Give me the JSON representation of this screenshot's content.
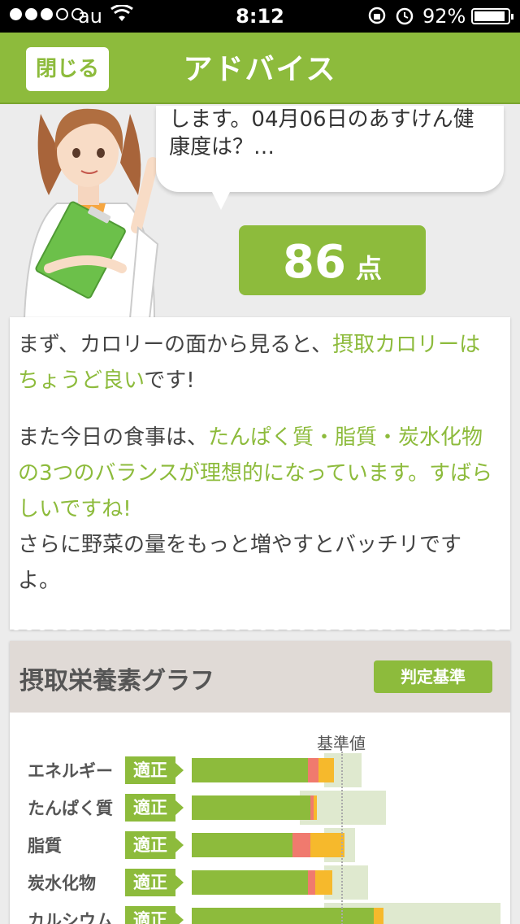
{
  "status_bar": {
    "carrier": "au",
    "time": "8:12",
    "battery": "92%",
    "battery_level": 0.92,
    "signal_bars": 3
  },
  "header": {
    "close_label": "閉じる",
    "title": "アドバイス"
  },
  "bubble": {
    "line1": "します。04月06日のあすけん健",
    "line2": "康度は？…"
  },
  "score": {
    "value": "86",
    "unit": "点"
  },
  "advice": {
    "p1_a": "まず、カロリーの面から見ると、",
    "p1_hl": "摂取カロリーはちょうど良い",
    "p1_b": "です!",
    "p2_a": "また今日の食事は、",
    "p2_hl": "たんぱく質・脂質・炭水化物の3つのバランスが理想的になっています。すばらしいですね!",
    "p3": "さらに野菜の量をもっと増やすとバッチリですよ。"
  },
  "graph": {
    "title": "摂取栄養素グラフ",
    "criteria_label": "判定基準",
    "reference_label": "基準値",
    "rows": [
      {
        "label": "エネルギー",
        "status": "適正",
        "green": 0.375,
        "red": 0.035,
        "orange": 0.05,
        "ideal_start": 0.43,
        "ideal_end": 0.55
      },
      {
        "label": "たんぱく質",
        "status": "適正",
        "green": 0.385,
        "red": 0.01,
        "orange": 0.01,
        "ideal_start": 0.35,
        "ideal_end": 0.63
      },
      {
        "label": "脂質",
        "status": "適正",
        "green": 0.325,
        "red": 0.06,
        "orange": 0.11,
        "ideal_start": 0.43,
        "ideal_end": 0.53
      },
      {
        "label": "炭水化物",
        "status": "適正",
        "green": 0.375,
        "red": 0.025,
        "orange": 0.055,
        "ideal_start": 0.43,
        "ideal_end": 0.57
      },
      {
        "label": "カルシウム",
        "status": "適正",
        "green": 0.59,
        "red": 0.0,
        "orange": 0.03,
        "ideal_start": 0.43,
        "ideal_end": 1.0
      }
    ]
  },
  "colors": {
    "accent": "#8dbb3c",
    "red": "#f07a6e",
    "orange": "#f6b92c",
    "ideal": "#dfe9cf"
  }
}
